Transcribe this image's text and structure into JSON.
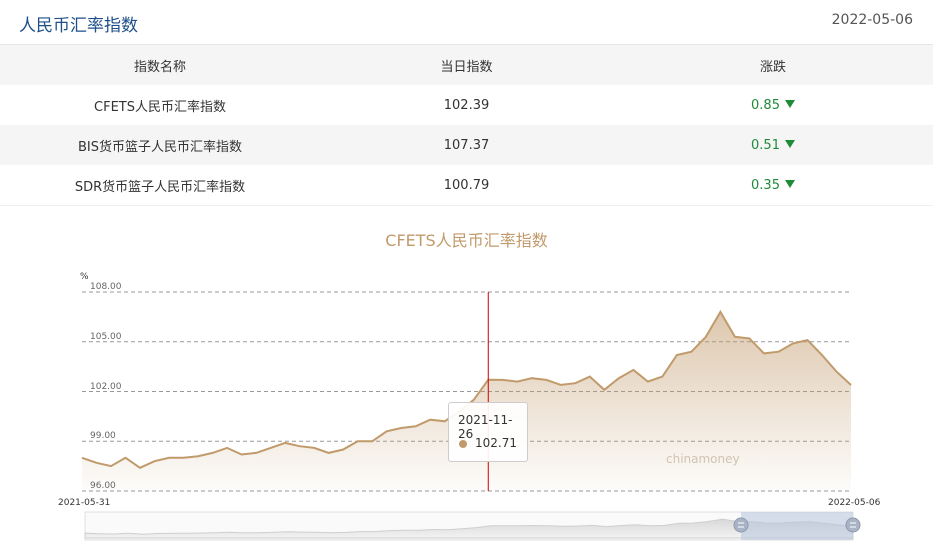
{
  "page": {
    "title": "人民币汇率指数",
    "date": "2022-05-06"
  },
  "table": {
    "headers": [
      "指数名称",
      "当日指数",
      "涨跌"
    ],
    "rows": [
      {
        "name": "CFETS人民币汇率指数",
        "value": "102.39",
        "change": "0.85",
        "direction": "down"
      },
      {
        "name": "BIS货币篮子人民币汇率指数",
        "value": "107.37",
        "change": "0.51",
        "direction": "down"
      },
      {
        "name": "SDR货币篮子人民币汇率指数",
        "value": "100.79",
        "change": "0.35",
        "direction": "down"
      }
    ]
  },
  "colors": {
    "title": "#1e4f8a",
    "down": "#1f8a3a",
    "series": "#c19a6b",
    "cursor": "#cc0000"
  },
  "chart_data": {
    "type": "area",
    "title": "CFETS人民币汇率指数",
    "unit": "%",
    "yticks": [
      "108.00",
      "105.00",
      "102.00",
      "99.00",
      "96.00"
    ],
    "ylim": [
      96,
      108
    ],
    "x_start_label": "2021-05-31",
    "x_end_label": "2022-05-06",
    "watermark": "chinamoney",
    "grid": true,
    "series": [
      {
        "values": [
          98.0,
          97.7,
          97.5,
          98.0,
          97.4,
          97.8,
          98.0,
          98.0,
          98.1,
          98.3,
          98.6,
          98.2,
          98.3,
          98.6,
          98.9,
          98.7,
          98.6,
          98.3,
          98.5,
          99.0,
          99.0,
          99.6,
          99.8,
          99.9,
          100.3,
          100.2,
          100.8,
          101.5,
          102.71,
          102.7,
          102.6,
          102.8,
          102.7,
          102.4,
          102.5,
          102.9,
          102.1,
          102.8,
          103.3,
          102.6,
          102.9,
          104.2,
          104.4,
          105.3,
          106.8,
          105.3,
          105.2,
          104.3,
          104.4,
          104.9,
          105.1,
          104.2,
          103.2,
          102.39
        ]
      }
    ],
    "tooltip": {
      "date": "2021-11-26",
      "value": "102.71",
      "index": 28
    }
  }
}
